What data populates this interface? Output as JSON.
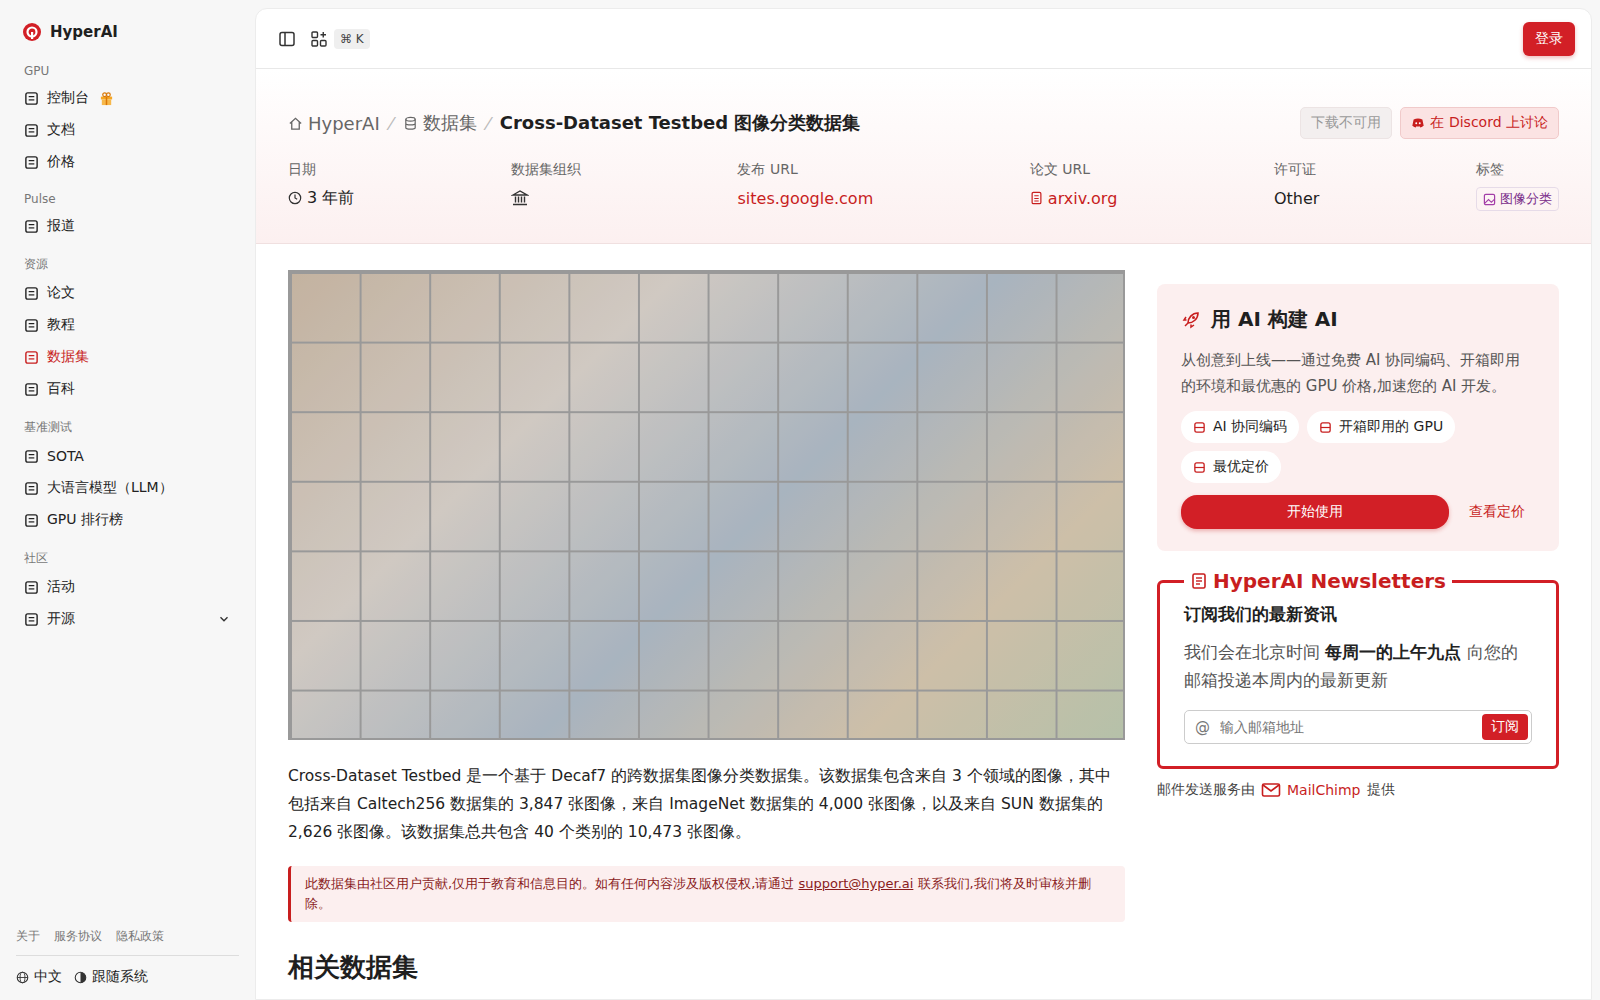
{
  "sidebar": {
    "brand": "HyperAI",
    "sections": [
      {
        "label": "GPU",
        "items": [
          {
            "label": "控制台",
            "selected": false,
            "gift": true,
            "expandable": false,
            "expanded": false
          },
          {
            "label": "文档",
            "selected": false,
            "gift": false,
            "expandable": false,
            "expanded": false
          },
          {
            "label": "价格",
            "selected": false,
            "gift": false,
            "expandable": false,
            "expanded": false
          }
        ]
      },
      {
        "label": "Pulse",
        "items": [
          {
            "label": "报道",
            "selected": false,
            "gift": false,
            "expandable": false,
            "expanded": false
          }
        ]
      },
      {
        "label": "资源",
        "items": [
          {
            "label": "论文",
            "selected": false,
            "gift": false,
            "expandable": false,
            "expanded": false
          },
          {
            "label": "教程",
            "selected": false,
            "gift": false,
            "expandable": false,
            "expanded": false
          },
          {
            "label": "数据集",
            "selected": true,
            "gift": false,
            "expandable": false,
            "expanded": false
          },
          {
            "label": "百科",
            "selected": false,
            "gift": false,
            "expandable": false,
            "expanded": false
          }
        ]
      },
      {
        "label": "基准测试",
        "items": [
          {
            "label": "SOTA",
            "selected": false,
            "gift": false,
            "expandable": false,
            "expanded": false
          },
          {
            "label": "大语言模型（LLM）",
            "selected": false,
            "gift": false,
            "expandable": false,
            "expanded": false
          },
          {
            "label": "GPU 排行榜",
            "selected": false,
            "gift": false,
            "expandable": false,
            "expanded": false
          }
        ]
      },
      {
        "label": "社区",
        "items": [
          {
            "label": "活动",
            "selected": false,
            "gift": false,
            "expandable": false,
            "expanded": false
          },
          {
            "label": "开源",
            "selected": false,
            "gift": false,
            "expandable": true,
            "expanded": false
          }
        ]
      }
    ],
    "footer_links": [
      "关于",
      "服务协议",
      "隐私政策"
    ],
    "language": "中文",
    "theme": "跟随系统"
  },
  "topbar": {
    "shortcut": "⌘ K",
    "login": "登录"
  },
  "breadcrumb": [
    "HyperAI",
    "数据集",
    "Cross-Dataset Testbed 图像分类数据集"
  ],
  "actions": [
    {
      "label": "下载不可用",
      "disabled": true
    },
    {
      "label": "在 Discord 上讨论",
      "disabled": false
    }
  ],
  "meta": [
    {
      "label": "日期",
      "value": "3 年前",
      "kind": "date"
    },
    {
      "label": "数据集组织",
      "value": "",
      "kind": "org"
    },
    {
      "label": "发布 URL",
      "value": "sites.google.com",
      "kind": "link"
    },
    {
      "label": "论文 URL",
      "value": "arxiv.org",
      "kind": "paper"
    },
    {
      "label": "许可证",
      "value": "Other",
      "kind": "text"
    },
    {
      "label": "标签",
      "value": "图像分类",
      "kind": "tag"
    }
  ],
  "description": "Cross-Dataset Testbed 是一个基于 Decaf7 的跨数据集图像分类数据集。该数据集包含来自 3 个领域的图像，其中包括来自 Caltech256 数据集的 3,847 张图像，来自 ImageNet 数据集的 4,000 张图像，以及来自 SUN 数据集的 2,626 张图像。该数据集总共包含 40 个类别的 10,473 张图像。",
  "notice": {
    "before": "此数据集由社区用户贡献,仅用于教育和信息目的。如有任何内容涉及版权侵权,请通过 ",
    "link": "support@hyper.ai",
    "after": " 联系我们,我们将及时审核并删除。"
  },
  "related_heading": "相关数据集",
  "promo": {
    "title": "用 AI 构建 AI",
    "text": "从创意到上线——通过免费 AI 协同编码、开箱即用的环境和最优惠的 GPU 价格,加速您的 AI 开发。",
    "features": [
      "AI 协同编码",
      "开箱即用的 GPU",
      "最优定价"
    ],
    "start": "开始使用",
    "pricing": "查看定价"
  },
  "newsletter": {
    "legend": "HyperAI Newsletters",
    "title": "订阅我们的最新资讯",
    "before": "我们会在北京时间 ",
    "bold": "每周一的上午九点",
    "after": " 向您的邮箱投递本周内的最新更新",
    "placeholder": "输入邮箱地址",
    "at": "@",
    "button": "订阅"
  },
  "mail_footer": {
    "before": "邮件发送服务由",
    "brand": "MailChimp",
    "after": "提供"
  }
}
